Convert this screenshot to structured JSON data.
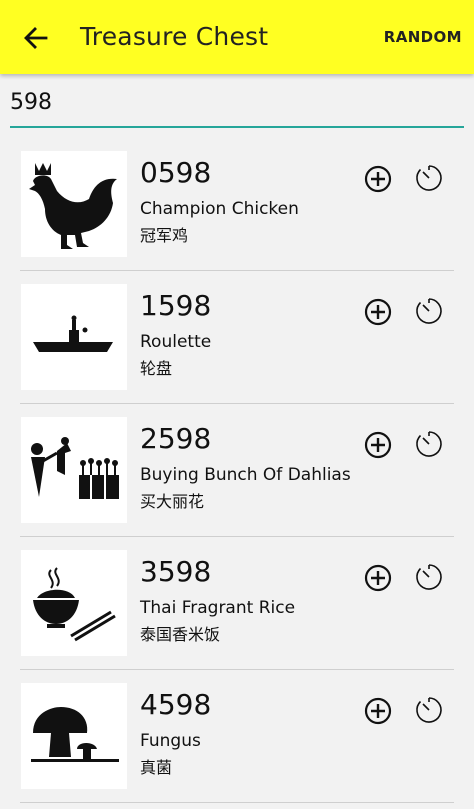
{
  "appbar": {
    "title": "Treasure Chest",
    "random_label": "RANDOM"
  },
  "search": {
    "value": "598"
  },
  "items": [
    {
      "number": "0598",
      "name_en": "Champion Chicken",
      "name_zh": "冠军鸡",
      "icon": "rooster-icon"
    },
    {
      "number": "1598",
      "name_en": "Roulette",
      "name_zh": "轮盘",
      "icon": "boat-icon"
    },
    {
      "number": "2598",
      "name_en": "Buying Bunch Of Dahlias",
      "name_zh": "买大丽花",
      "icon": "flower-buyer-icon"
    },
    {
      "number": "3598",
      "name_en": "Thai Fragrant Rice",
      "name_zh": "泰国香米饭",
      "icon": "rice-bowl-icon"
    },
    {
      "number": "4598",
      "name_en": "Fungus",
      "name_zh": "真菌",
      "icon": "mushroom-icon"
    }
  ]
}
